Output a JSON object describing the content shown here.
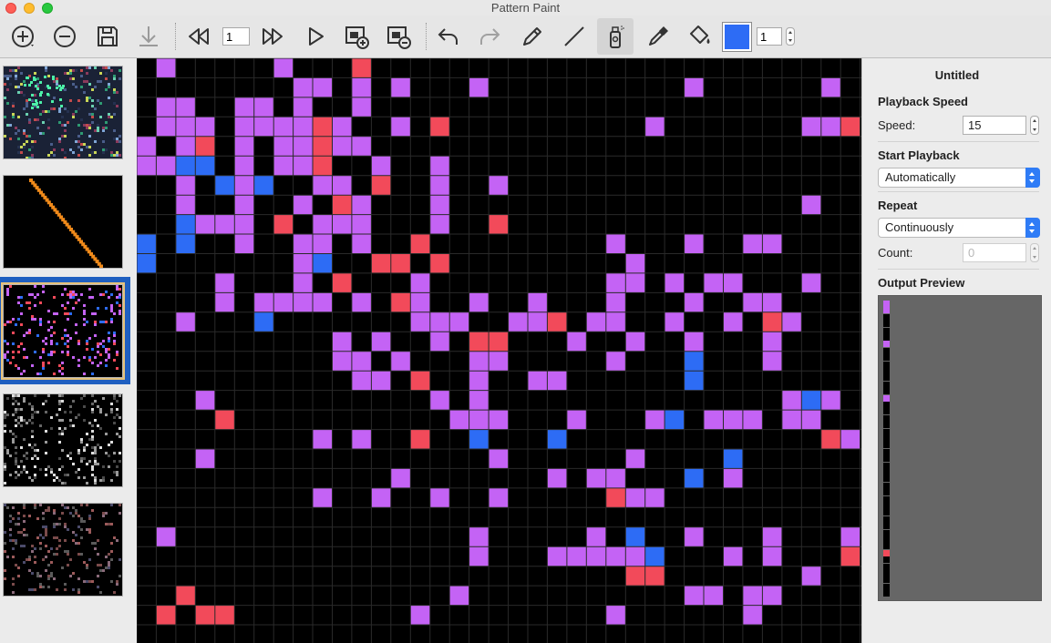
{
  "window": {
    "title": "Pattern Paint"
  },
  "toolbar": {
    "tools": [
      {
        "name": "add-frame-icon"
      },
      {
        "name": "remove-frame-icon"
      },
      {
        "name": "save-icon"
      },
      {
        "name": "download-icon"
      },
      {
        "name": "rewind-icon"
      },
      {
        "name": "fast-forward-icon"
      },
      {
        "name": "play-icon"
      },
      {
        "name": "add-frame-after-icon"
      },
      {
        "name": "delete-frame-icon"
      },
      {
        "name": "undo-icon"
      },
      {
        "name": "redo-icon"
      },
      {
        "name": "pencil-icon"
      },
      {
        "name": "line-icon"
      },
      {
        "name": "spray-icon"
      },
      {
        "name": "eyedropper-icon"
      },
      {
        "name": "fill-bucket-icon"
      }
    ],
    "frame_number": "1",
    "brush_size": "1",
    "current_color": "#2d6cf5"
  },
  "frames": [
    {
      "name": "frame-1"
    },
    {
      "name": "frame-2"
    },
    {
      "name": "frame-3",
      "selected": true
    },
    {
      "name": "frame-4"
    },
    {
      "name": "frame-5"
    }
  ],
  "palette": {
    "black": "#000000",
    "purple": "#c463f5",
    "red": "#f24a5a",
    "blue": "#2d6cf5"
  },
  "canvas": {
    "rows": [
      ".p.....p...r..................................p.pp",
      "........pp.p.p...p..........p......p.......ppb",
      ".pp..pp.p..p...........................pprr",
      ".ppp.pppprp..p.r..........p.......pprbb",
      "p.pr.p.pprpp..........................p...p.....p",
      "ppbb.p.ppr..p..p.........................pp.pb..",
      "..p.bpb..pp.r..p..p........................pb.p.p",
      "..p..p..p.rp...p..................p....r",
      "..bppp.r.ppp...p..r......................p.p.bpp",
      "b.b..p..pp.p..r.........p...p..pp....p.p..b",
      "b.......pb..rr.r.........p....................p..",
      "....p...p.r...p.........pp.p.pp...p............p.",
      "....p.pppp.p.rp..p..p...p...p..pp.....p.........",
      "..p...b.......ppp..ppr.pp..p..p.rp..............",
      "..........p.p..p.rr...p..p..p...p........pp...",
      "..........pp.p...pp.....p...b...p.......p......",
      "...........pp.r..p..pp......b...............p..",
      "...p...........p.p...............pbp.pp.p..p...",
      "....r...........ppp...p...pb.ppp.pp...p...",
      ".........p.p..r..b...b.............rp..p........",
      "...p..............p......p....b...........p.........",
      ".............p.......p.pp...b.p..................",
      ".........p..p..p..p.....rpp..........p.............",
      "........................................p..",
      ".p...............p.....p.b..p...p...p...p..p......p",
      ".................p...pppppb...p.p...r..rr.......",
      ".........................rr.......p..p..p.r..p.",
      "..r.............p...........pp.pp....p..r.pp.p",
      ".r.rr.........p.........p......p......p...p",
      "................................................",
      "......................................................"
    ]
  },
  "right_panel": {
    "doc_title": "Untitled",
    "playback_speed_heading": "Playback Speed",
    "speed_label": "Speed:",
    "speed_value": "15",
    "start_playback_heading": "Start Playback",
    "start_playback_value": "Automatically",
    "repeat_heading": "Repeat",
    "repeat_value": "Continuously",
    "count_label": "Count:",
    "count_value": "0",
    "output_preview_heading": "Output Preview",
    "preview_leds": [
      "p",
      "p",
      ".",
      ".",
      ".",
      ".",
      "p",
      ".",
      ".",
      ".",
      ".",
      ".",
      ".",
      ".",
      "p",
      ".",
      ".",
      ".",
      ".",
      ".",
      ".",
      ".",
      ".",
      ".",
      ".",
      ".",
      ".",
      ".",
      ".",
      ".",
      ".",
      ".",
      ".",
      ".",
      ".",
      ".",
      ".",
      "r",
      ".",
      ".",
      ".",
      ".",
      ".",
      "."
    ]
  }
}
